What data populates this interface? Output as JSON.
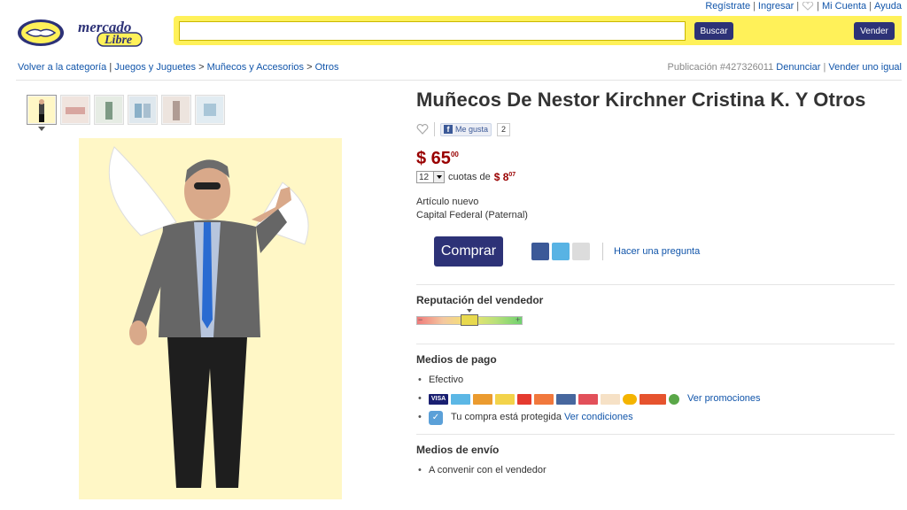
{
  "toplinks": {
    "register": "Regístrate",
    "sep1": "|",
    "login": "Ingresar",
    "sep2": "|",
    "sep3": "|",
    "account": "Mi Cuenta",
    "sep4": "|",
    "help": "Ayuda"
  },
  "header": {
    "logo_text_top": "mercado",
    "logo_text_bottom": "Libre",
    "search_value": "",
    "search_button": "Buscar",
    "sell_button": "Vender"
  },
  "breadcrumbs": {
    "back": "Volver a la categoría",
    "sep": "|",
    "cat1": "Juegos y Juguetes",
    "arrow1": ">",
    "cat2": "Muñecos y Accesorios",
    "arrow2": ">",
    "cat3": "Otros"
  },
  "publication": {
    "label": "Publicación #427326011",
    "report": "Denunciar",
    "sep": "|",
    "sell_same": "Vender uno igual"
  },
  "product": {
    "title": "Muñecos De Nestor Kirchner Cristina K. Y Otros",
    "like_label": "Me gusta",
    "like_count": "2",
    "price_main": "$ 65",
    "price_cents": "00",
    "installments_count": "12",
    "installments_text": "cuotas de",
    "installment_main": "$ 8",
    "installment_cents": "07",
    "condition": "Artículo nuevo",
    "location": "Capital Federal (Paternal)",
    "buy_button": "Comprar",
    "ask_link": "Hacer una pregunta"
  },
  "reputation": {
    "heading": "Reputación del vendedor",
    "level": 0.5
  },
  "payment": {
    "heading": "Medios de pago",
    "cash": "Efectivo",
    "visa": "VISA",
    "promos": "Ver promociones",
    "protected_text": "Tu compra está protegida",
    "conditions_link": "Ver condiciones"
  },
  "shipping": {
    "heading": "Medios de envío",
    "option": "A convenir con el vendedor"
  },
  "colors": {
    "brand_yellow": "#fff159",
    "brand_blue": "#2d3277",
    "price_red": "#990000",
    "link_blue": "#1155aa"
  }
}
